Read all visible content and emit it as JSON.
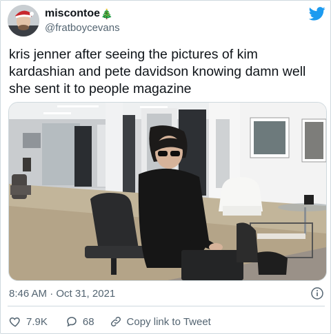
{
  "author": {
    "display_name": "miscontoe",
    "name_emoji": "🎄",
    "handle": "@fratboycevans"
  },
  "platform_icon": "twitter-bird-icon",
  "tweet": {
    "text": "kris jenner after seeing the pictures of kim kardashian and pete davidson knowing damn well she sent it to people magazine",
    "timestamp": "8:46 AM · Oct 31, 2021"
  },
  "actions": {
    "likes": "7.9K",
    "replies": "68",
    "copy_link_label": "Copy link to Tweet"
  },
  "colors": {
    "brand_blue": "#1d9bf0",
    "text_primary": "#0f1419",
    "text_secondary": "#536471",
    "border": "#cfd9de"
  }
}
